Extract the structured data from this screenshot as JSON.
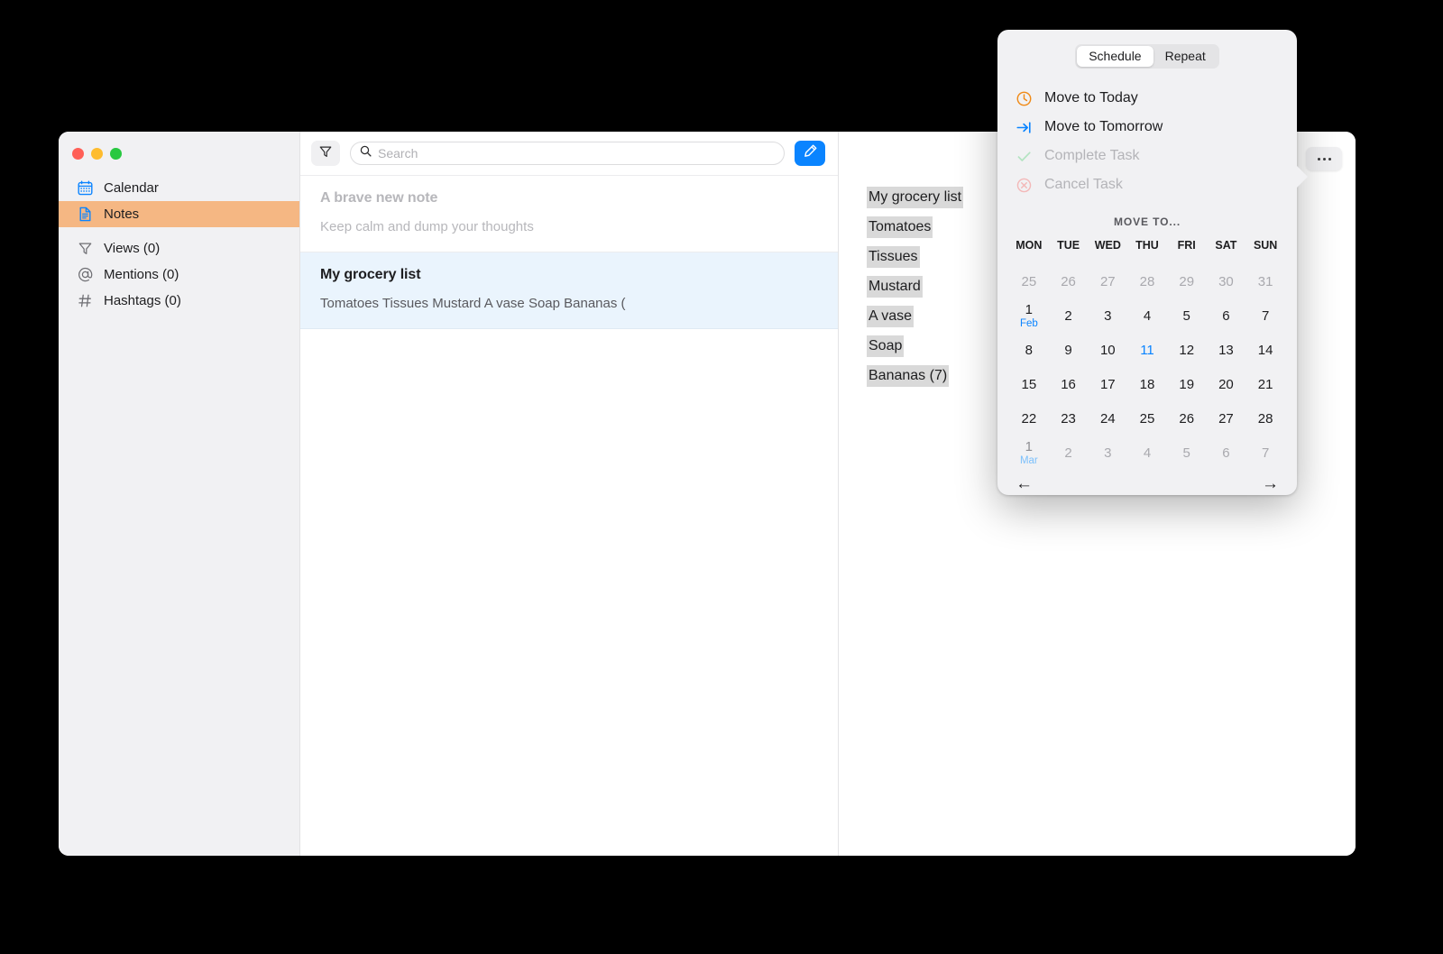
{
  "sidebar": {
    "traffic_lights": [
      "close",
      "minimize",
      "zoom"
    ],
    "items": [
      {
        "label": "Calendar",
        "icon": "calendar-icon",
        "selected": false
      },
      {
        "label": "Notes",
        "icon": "note-icon",
        "selected": true
      },
      {
        "label": "Views (0)",
        "icon": "filter-icon",
        "selected": false
      },
      {
        "label": "Mentions (0)",
        "icon": "at-icon",
        "selected": false
      },
      {
        "label": "Hashtags (0)",
        "icon": "hashtag-icon",
        "selected": false
      }
    ]
  },
  "toolbar": {
    "filter_icon": "filter-icon",
    "search_icon": "search-icon",
    "search_value": "",
    "search_placeholder": "Search",
    "compose_icon": "pencil-icon"
  },
  "notes": [
    {
      "title": "A brave new note",
      "subtitle": "Keep calm and dump your thoughts",
      "state": "placeholder"
    },
    {
      "title": "My grocery list",
      "subtitle": "Tomatoes Tissues Mustard A vase Soap Bananas (",
      "state": "active"
    }
  ],
  "editor": {
    "more_button_label": "•••",
    "lines": [
      "My grocery list",
      "Tomatoes",
      "Tissues",
      "Mustard",
      "A vase",
      "Soap",
      "Bananas (7)"
    ]
  },
  "popover": {
    "tabs": [
      {
        "label": "Schedule",
        "active": true
      },
      {
        "label": "Repeat",
        "active": false
      }
    ],
    "menu": [
      {
        "label": "Move to Today",
        "icon": "clock-icon",
        "disabled": false
      },
      {
        "label": "Move to Tomorrow",
        "icon": "arrow-to-end-icon",
        "disabled": false
      },
      {
        "label": "Complete Task",
        "icon": "check-icon",
        "disabled": true
      },
      {
        "label": "Cancel Task",
        "icon": "x-circle-icon",
        "disabled": true
      }
    ],
    "move_to_label": "MOVE TO...",
    "weekdays": [
      "MON",
      "TUE",
      "WED",
      "THU",
      "FRI",
      "SAT",
      "SUN"
    ],
    "days": [
      {
        "num": "25",
        "month": "",
        "dim": true,
        "selected": false,
        "hover": false
      },
      {
        "num": "26",
        "month": "",
        "dim": true,
        "selected": false,
        "hover": false
      },
      {
        "num": "27",
        "month": "",
        "dim": true,
        "selected": false,
        "hover": false
      },
      {
        "num": "28",
        "month": "",
        "dim": true,
        "selected": false,
        "hover": false
      },
      {
        "num": "29",
        "month": "",
        "dim": true,
        "selected": false,
        "hover": false
      },
      {
        "num": "30",
        "month": "",
        "dim": true,
        "selected": false,
        "hover": false
      },
      {
        "num": "31",
        "month": "",
        "dim": true,
        "selected": false,
        "hover": false
      },
      {
        "num": "1",
        "month": "Feb",
        "dim": false,
        "selected": false,
        "hover": false
      },
      {
        "num": "2",
        "month": "",
        "dim": false,
        "selected": false,
        "hover": false
      },
      {
        "num": "3",
        "month": "",
        "dim": false,
        "selected": false,
        "hover": false
      },
      {
        "num": "4",
        "month": "",
        "dim": false,
        "selected": false,
        "hover": false
      },
      {
        "num": "5",
        "month": "",
        "dim": false,
        "selected": false,
        "hover": false
      },
      {
        "num": "6",
        "month": "",
        "dim": false,
        "selected": false,
        "hover": false
      },
      {
        "num": "7",
        "month": "",
        "dim": false,
        "selected": false,
        "hover": false
      },
      {
        "num": "8",
        "month": "",
        "dim": false,
        "selected": false,
        "hover": false
      },
      {
        "num": "9",
        "month": "",
        "dim": false,
        "selected": false,
        "hover": false
      },
      {
        "num": "10",
        "month": "",
        "dim": false,
        "selected": false,
        "hover": false
      },
      {
        "num": "11",
        "month": "",
        "dim": false,
        "selected": true,
        "hover": false
      },
      {
        "num": "12",
        "month": "",
        "dim": false,
        "selected": false,
        "hover": false
      },
      {
        "num": "13",
        "month": "",
        "dim": false,
        "selected": false,
        "hover": false
      },
      {
        "num": "14",
        "month": "",
        "dim": false,
        "selected": false,
        "hover": false
      },
      {
        "num": "15",
        "month": "",
        "dim": false,
        "selected": false,
        "hover": false
      },
      {
        "num": "16",
        "month": "",
        "dim": false,
        "selected": false,
        "hover": false
      },
      {
        "num": "17",
        "month": "",
        "dim": false,
        "selected": false,
        "hover": false
      },
      {
        "num": "18",
        "month": "",
        "dim": false,
        "selected": false,
        "hover": false
      },
      {
        "num": "19",
        "month": "",
        "dim": false,
        "selected": false,
        "hover": true
      },
      {
        "num": "20",
        "month": "",
        "dim": false,
        "selected": false,
        "hover": false
      },
      {
        "num": "21",
        "month": "",
        "dim": false,
        "selected": false,
        "hover": false
      },
      {
        "num": "22",
        "month": "",
        "dim": false,
        "selected": false,
        "hover": false
      },
      {
        "num": "23",
        "month": "",
        "dim": false,
        "selected": false,
        "hover": false
      },
      {
        "num": "24",
        "month": "",
        "dim": false,
        "selected": false,
        "hover": false
      },
      {
        "num": "25",
        "month": "",
        "dim": false,
        "selected": false,
        "hover": false
      },
      {
        "num": "26",
        "month": "",
        "dim": false,
        "selected": false,
        "hover": false
      },
      {
        "num": "27",
        "month": "",
        "dim": false,
        "selected": false,
        "hover": false
      },
      {
        "num": "28",
        "month": "",
        "dim": false,
        "selected": false,
        "hover": false
      },
      {
        "num": "1",
        "month": "Mar",
        "dim": true,
        "selected": false,
        "hover": false
      },
      {
        "num": "2",
        "month": "",
        "dim": true,
        "selected": false,
        "hover": false
      },
      {
        "num": "3",
        "month": "",
        "dim": true,
        "selected": false,
        "hover": false
      },
      {
        "num": "4",
        "month": "",
        "dim": true,
        "selected": false,
        "hover": false
      },
      {
        "num": "5",
        "month": "",
        "dim": true,
        "selected": false,
        "hover": false
      },
      {
        "num": "6",
        "month": "",
        "dim": true,
        "selected": false,
        "hover": false
      },
      {
        "num": "7",
        "month": "",
        "dim": true,
        "selected": false,
        "hover": false
      }
    ],
    "prev_arrow": "←",
    "next_arrow": "→"
  },
  "colors": {
    "accent_blue": "#0a84ff",
    "selection_orange": "#f5b783",
    "note_active_blue": "#eaf4fd",
    "text_selection_gray": "#d9d9d9",
    "today_orange": "#f08a16",
    "window_bg": "#ffffff",
    "sidebar_bg": "#f1f1f3",
    "popover_bg": "#f1f1f3",
    "page_bg": "#000000"
  }
}
